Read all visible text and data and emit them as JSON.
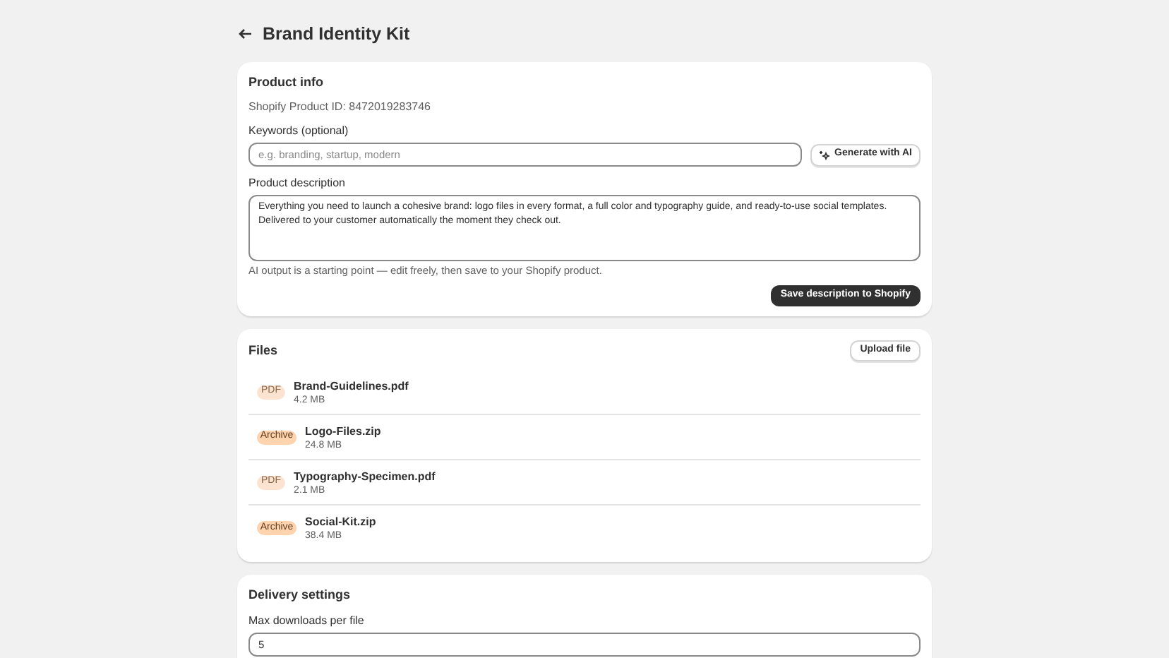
{
  "page": {
    "title": "Brand Identity Kit"
  },
  "product_info": {
    "heading": "Product info",
    "product_id": "Shopify Product ID: 8472019283746",
    "keywords_label": "Keywords (optional)",
    "keywords_placeholder": "e.g. branding, startup, modern",
    "generate_button": "Generate with AI",
    "description_label": "Product description",
    "description": "Everything you need to launch a cohesive brand: logo files in every format, a full color and typography guide, and ready-to-use social templates. Delivered to your customer automatically the moment they check out.",
    "hint": "AI output is a starting point — edit freely, then save to your Shopify product.",
    "save_button": "Save description to Shopify"
  },
  "files": {
    "heading": "Files",
    "upload_button": "Upload file",
    "items": [
      {
        "kind": "pdf",
        "badge": "PDF",
        "name": "Brand-Guidelines.pdf",
        "size": "4.2 MB"
      },
      {
        "kind": "archive",
        "badge": "Archive",
        "name": "Logo-Files.zip",
        "size": "24.8 MB"
      },
      {
        "kind": "pdf",
        "badge": "PDF",
        "name": "Typography-Specimen.pdf",
        "size": "2.1 MB"
      },
      {
        "kind": "archive",
        "badge": "Archive",
        "name": "Social-Kit.zip",
        "size": "38.4 MB"
      }
    ]
  },
  "delivery": {
    "heading": "Delivery settings",
    "max_downloads_label": "Max downloads per file",
    "max_downloads_value": "5"
  }
}
